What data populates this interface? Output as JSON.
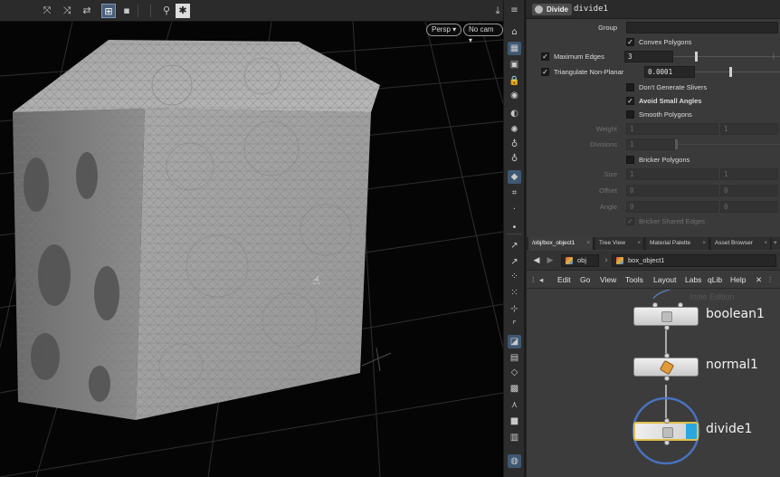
{
  "viewport": {
    "camera_label": "Persp",
    "cam_select_label": "No cam",
    "toolbar_icons": [
      "select-icon",
      "transform-icon",
      "handle-icon",
      "snap-icon",
      "display-icon",
      "network-icon",
      "settings-icon"
    ]
  },
  "params": {
    "node_type": "Divide",
    "node_name": "divide1",
    "group_label": "Group",
    "group_value": "",
    "convex_polygons_label": "Convex Polygons",
    "max_edges_label": "Maximum Edges",
    "max_edges_value": "3",
    "max_edges_slider": 0.2,
    "triangulate_label": "Triangulate Non-Planar",
    "triangulate_value": "0.0001",
    "triangulate_slider": 0.4,
    "dont_slivers_label": "Don't Generate Slivers",
    "avoid_small_label": "Avoid Small Angles",
    "smooth_label": "Smooth Polygons",
    "weight_label": "Weight",
    "weight_a": "1",
    "weight_b": "1",
    "divisions_label": "Divisions",
    "divisions_value": "1",
    "bricker_label": "Bricker Polygons",
    "size_label": "Size",
    "size_a": "1",
    "size_b": "1",
    "offset_label": "Offset",
    "offset_a": "0",
    "offset_b": "0",
    "angle_label": "Angle",
    "angle_a": "0",
    "angle_b": "0",
    "bricker_shared_label": "Bricker Shared Edges"
  },
  "network": {
    "tabs": [
      "/obj/box_object1",
      "Tree View",
      "Material Palette",
      "Asset Browser"
    ],
    "path_root": "obj",
    "path_current": "box_object1",
    "menu": [
      "Edit",
      "Go",
      "View",
      "Tools",
      "Layout",
      "Labs",
      "qLib",
      "Help"
    ],
    "watermark": "Indie Edition",
    "nodes": [
      {
        "name": "boolean1"
      },
      {
        "name": "normal1"
      },
      {
        "name": "divide1"
      }
    ]
  },
  "colors": {
    "selection_ring": "#4a78c9",
    "display_flag": "#2aa7e0",
    "node_outline_selected": "#e0c04a"
  }
}
